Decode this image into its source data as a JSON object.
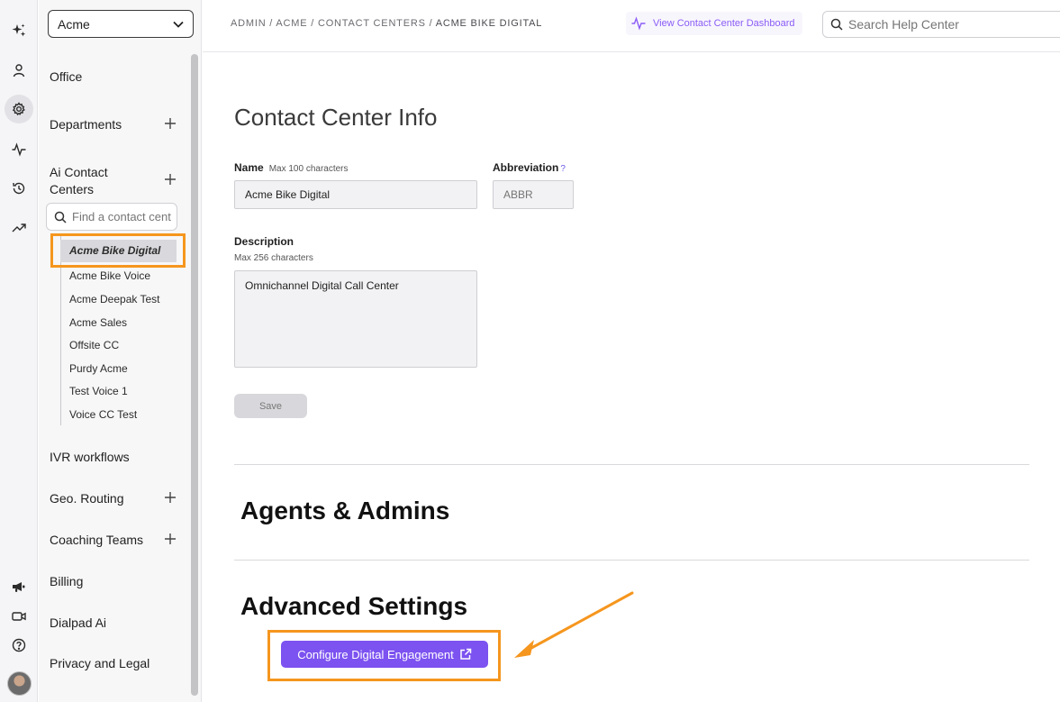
{
  "org_select": {
    "value": "Acme"
  },
  "sidebar": {
    "items": [
      {
        "label": "Office"
      },
      {
        "label": "Departments"
      },
      {
        "label": "Ai Contact Centers"
      },
      {
        "label": "IVR workflows"
      },
      {
        "label": "Geo. Routing"
      },
      {
        "label": "Coaching Teams"
      },
      {
        "label": "Billing"
      },
      {
        "label": "Dialpad Ai"
      },
      {
        "label": "Privacy and Legal"
      }
    ],
    "contact_center_search": {
      "placeholder": "Find a contact center"
    },
    "contact_centers": [
      "Acme Bike Digital",
      "Acme Bike Voice",
      "Acme Deepak Test",
      "Acme Sales",
      "Offsite CC",
      "Purdy Acme",
      "Test Voice 1",
      "Voice CC Test"
    ]
  },
  "topbar": {
    "breadcrumb": "ADMIN / ACME / CONTACT CENTERS / ",
    "breadcrumb_current": "ACME BIKE DIGITAL",
    "dashboard_link": "View Contact Center Dashboard",
    "help_search_placeholder": "Search Help Center"
  },
  "form": {
    "title": "Contact Center Info",
    "name_label": "Name",
    "name_hint": "Max 100 characters",
    "name_value": "Acme Bike Digital",
    "abbr_label": "Abbreviation",
    "abbr_help": "?",
    "abbr_placeholder": "ABBR",
    "desc_label": "Description",
    "desc_hint": "Max 256 characters",
    "desc_value": "Omnichannel Digital Call Center",
    "save_label": "Save"
  },
  "sections": {
    "agents_admins": "Agents & Admins",
    "advanced_settings": "Advanced Settings",
    "configure_button": "Configure Digital Engagement"
  },
  "colors": {
    "accent": "#7c52f0",
    "highlight": "#f5961e"
  }
}
